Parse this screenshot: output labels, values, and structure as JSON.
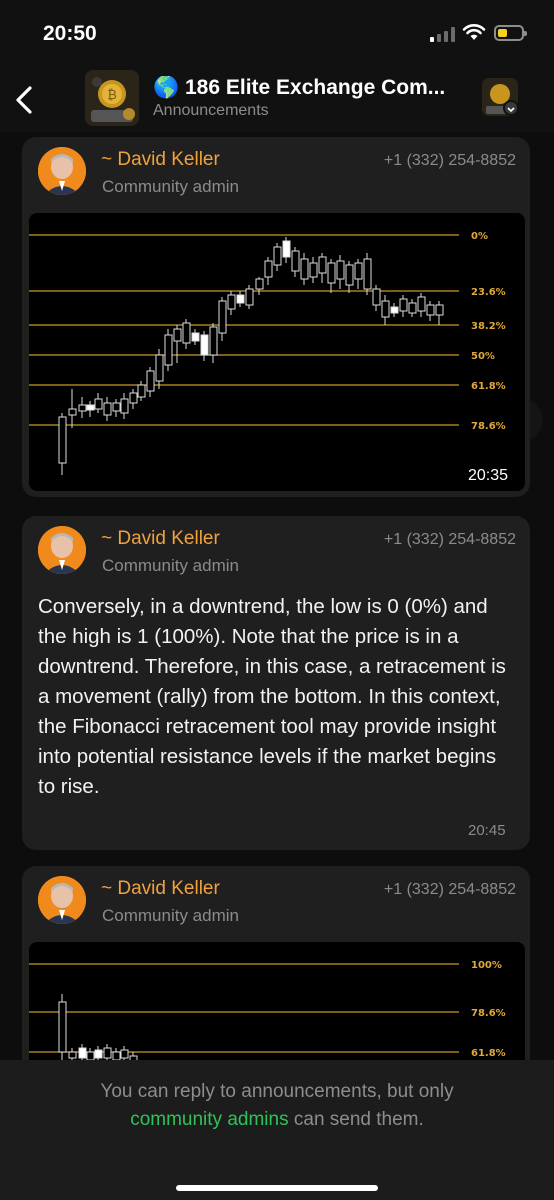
{
  "status_bar": {
    "time": "20:50",
    "battery_level": 0.4,
    "signal_bars_active": 1
  },
  "header": {
    "title": "🌎 186 Elite Exchange Com...",
    "subtitle": "Announcements"
  },
  "messages": [
    {
      "sender": "~ David Keller",
      "role": "Community admin",
      "phone": "+1 (332) 254-8852",
      "time": "20:35",
      "chart": {
        "fib_levels": [
          "0%",
          "23.6%",
          "38.2%",
          "50%",
          "61.8%",
          "78.6%"
        ]
      }
    },
    {
      "sender": "~ David Keller",
      "role": "Community admin",
      "phone": "+1 (332) 254-8852",
      "text": "Conversely, in a downtrend, the low is 0 (0%) and the high is 1 (100%). Note that the price is in a downtrend. Therefore, in this case, a retracement is a movement (rally) from the bottom. In this context, the Fibonacci retracement tool may provide insight into potential resistance levels if the market begins to rise.",
      "time": "20:45"
    },
    {
      "sender": "~ David Keller",
      "role": "Community admin",
      "phone": "+1 (332) 254-8852",
      "chart": {
        "fib_levels": [
          "100%",
          "78.6%",
          "61.8%"
        ]
      }
    }
  ],
  "footer": {
    "prefix": "You can reply to announcements, but only",
    "link": "community admins",
    "suffix": "can send them."
  },
  "colors": {
    "accent_green": "#2fc25a",
    "sender_orange": "#f0a23c",
    "fib_line": "#c79a2b"
  }
}
